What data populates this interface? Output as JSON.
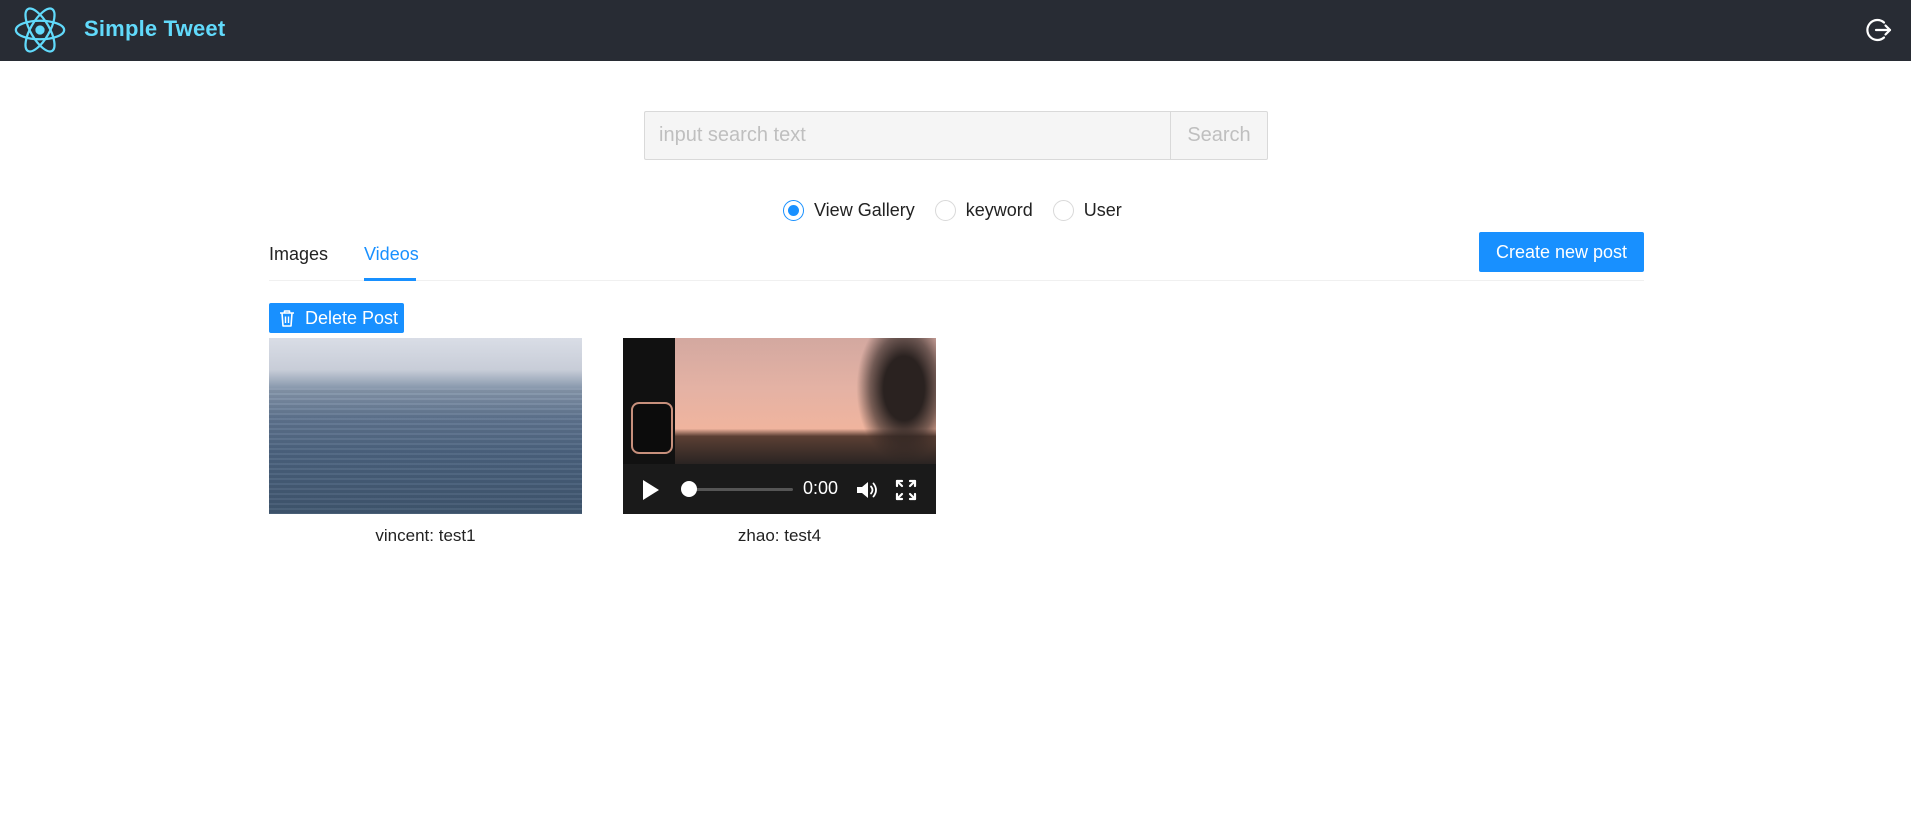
{
  "header": {
    "app_title": "Simple Tweet"
  },
  "search": {
    "placeholder": "input search text",
    "value": "",
    "button_label": "Search"
  },
  "search_mode": {
    "options": [
      {
        "label": "View Gallery",
        "checked": true
      },
      {
        "label": "keyword",
        "checked": false
      },
      {
        "label": "User",
        "checked": false
      }
    ]
  },
  "tabs": {
    "items": [
      {
        "label": "Images",
        "active": false
      },
      {
        "label": "Videos",
        "active": true
      }
    ]
  },
  "actions": {
    "create_label": "Create new post",
    "delete_label": "Delete Post"
  },
  "gallery": {
    "items": [
      {
        "caption": "vincent: test1"
      },
      {
        "caption": "zhao: test4",
        "video_time": "0:00",
        "video_progress": 0
      }
    ]
  },
  "colors": {
    "header_bg": "#282c34",
    "brand": "#61dafb",
    "primary": "#1890ff"
  },
  "icons": {
    "logo": "react-logo-icon",
    "logout": "logout-icon",
    "delete": "trash-icon",
    "play": "play-icon",
    "volume": "volume-icon",
    "fullscreen": "fullscreen-icon"
  }
}
